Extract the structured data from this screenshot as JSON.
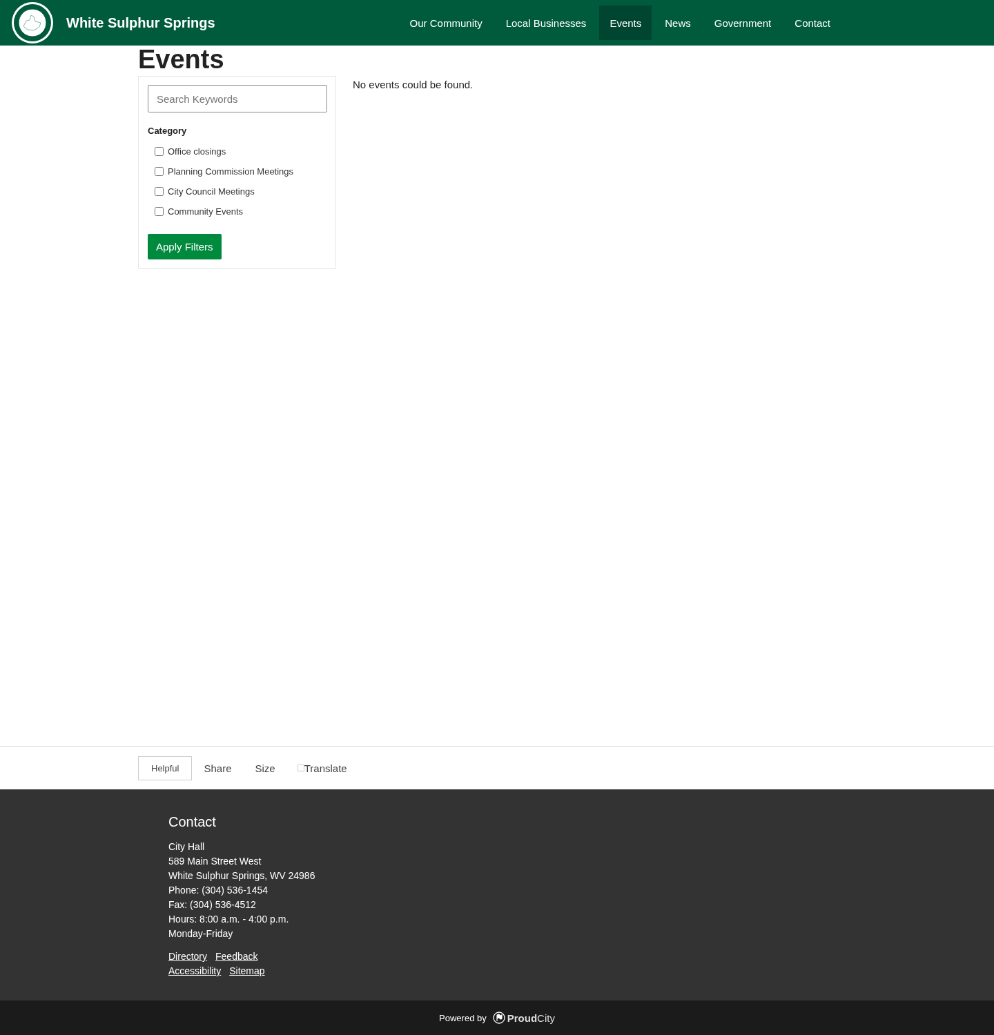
{
  "site": {
    "title": "White Sulphur Springs"
  },
  "nav": [
    {
      "label": "Our Community",
      "selected": false
    },
    {
      "label": "Local Businesses",
      "selected": false
    },
    {
      "label": "Events",
      "selected": true
    },
    {
      "label": "News",
      "selected": false
    },
    {
      "label": "Government",
      "selected": false
    },
    {
      "label": "Contact",
      "selected": false
    }
  ],
  "page_title": "Events",
  "filters": {
    "search": {
      "placeholder": "Search Keywords"
    },
    "category_label": "Category",
    "categories": [
      {
        "label": "Office closings",
        "checked": false
      },
      {
        "label": "Planning Commission Meetings",
        "checked": false
      },
      {
        "label": "City Council Meetings",
        "checked": false
      },
      {
        "label": "Community Events",
        "checked": false
      }
    ],
    "apply_button": "Apply Filters"
  },
  "message": "No events could be found.",
  "feedback_bar": [
    {
      "label": "Helpful",
      "kind": "outlined"
    },
    {
      "label": "Share",
      "kind": "plain"
    },
    {
      "label": "Size",
      "kind": "plain"
    },
    {
      "label": "Translate",
      "kind": "icon"
    }
  ],
  "footer": {
    "heading": "Contact",
    "lines": [
      "City Hall",
      "589 Main Street West",
      "White Sulphur Springs, WV 24986",
      "Phone: (304) 536-1454",
      "Fax: (304) 536-4512",
      "Hours: 8:00 a.m. - 4:00 p.m.",
      "Monday-Friday"
    ],
    "links": [
      [
        "Directory",
        "Feedback"
      ],
      [
        "Accessibility",
        "Sitemap"
      ]
    ]
  },
  "powered_by": {
    "text": "Powered by",
    "brand": "**Proud**City"
  }
}
